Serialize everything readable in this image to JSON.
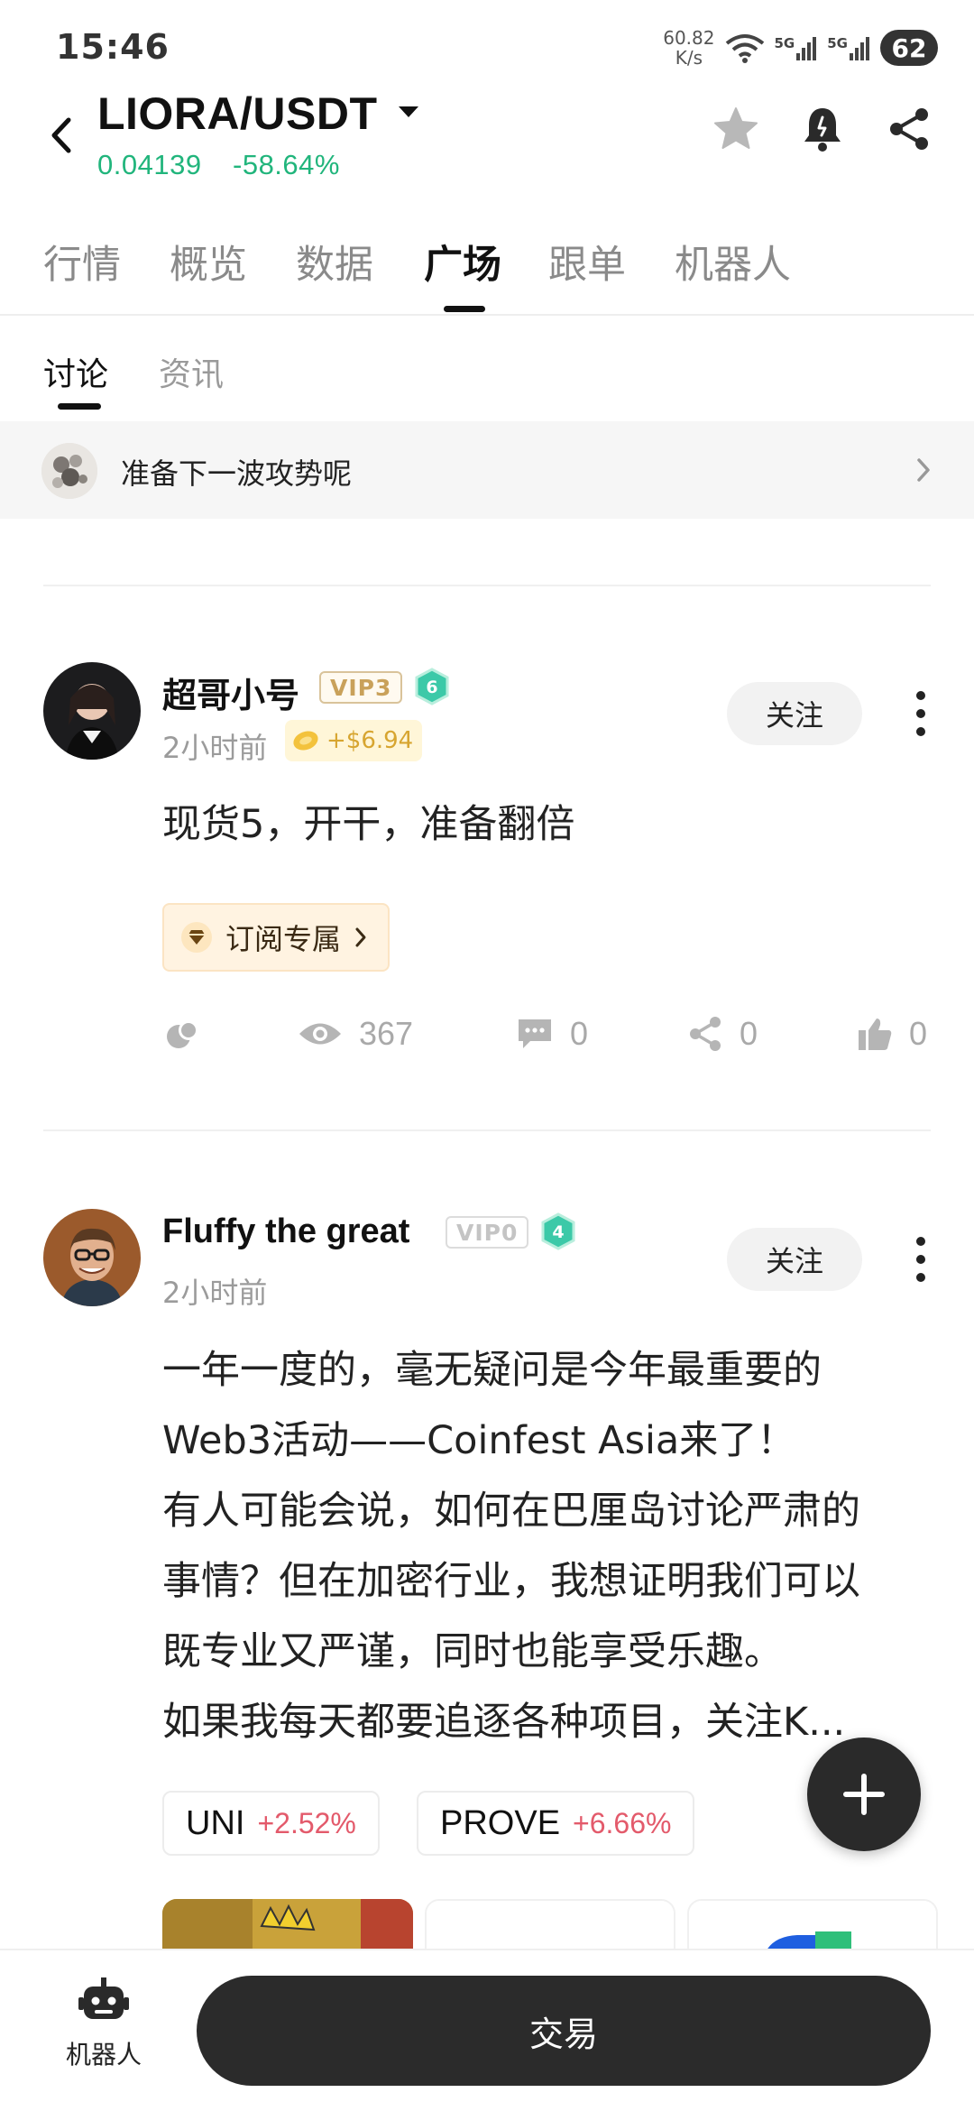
{
  "status_bar": {
    "time": "15:46",
    "net_speed_value": "60.82",
    "net_speed_unit": "K/s",
    "sim1": "5G",
    "sim2": "5G",
    "battery": "62"
  },
  "header": {
    "pair": "LIORA/USDT",
    "price": "0.04139",
    "change": "-58.64%",
    "change_color": "#21b57c"
  },
  "main_tabs": [
    {
      "label": "行情"
    },
    {
      "label": "概览"
    },
    {
      "label": "数据"
    },
    {
      "label": "广场",
      "active": true
    },
    {
      "label": "跟单"
    },
    {
      "label": "机器人"
    }
  ],
  "sub_tabs": [
    {
      "label": "讨论",
      "active": true
    },
    {
      "label": "资讯"
    }
  ],
  "pinned": {
    "text": "准备下一波攻势呢"
  },
  "posts": [
    {
      "username": "超哥小号",
      "vip": "VIP3",
      "level": "6",
      "time": "2小时前",
      "reward": "+$6.94",
      "follow_label": "关注",
      "body": "现货5，开干，准备翻倍",
      "subscription_label": "订阅专属",
      "stats": {
        "views": "367",
        "comments": "0",
        "shares": "0",
        "likes": "0"
      }
    },
    {
      "username": "Fluffy the great",
      "vip": "VIP0",
      "level": "4",
      "time": "2小时前",
      "follow_label": "关注",
      "body_lines": [
        "一年一度的，毫无疑问是今年最重要的",
        "Web3活动——Coinfest Asia来了！",
        "有人可能会说，如何在巴厘岛讨论严肃的",
        "事情？但在加密行业，我想证明我们可以",
        "既专业又严谨，同时也能享受乐趣。",
        "如果我每天都要追逐各种项目，关注K..."
      ],
      "coins": [
        {
          "symbol": "UNI",
          "change": "+2.52%"
        },
        {
          "symbol": "PROVE",
          "change": "+6.66%"
        }
      ]
    }
  ],
  "bottom_bar": {
    "robot_label": "机器人",
    "trade_label": "交易"
  },
  "colors": {
    "up_green": "#21b57c",
    "coin_red": "#e35a6b",
    "vip3_gold": "#c9a15a",
    "level_teal": "#3cc9a8",
    "dark_button": "#2b2b2b"
  }
}
